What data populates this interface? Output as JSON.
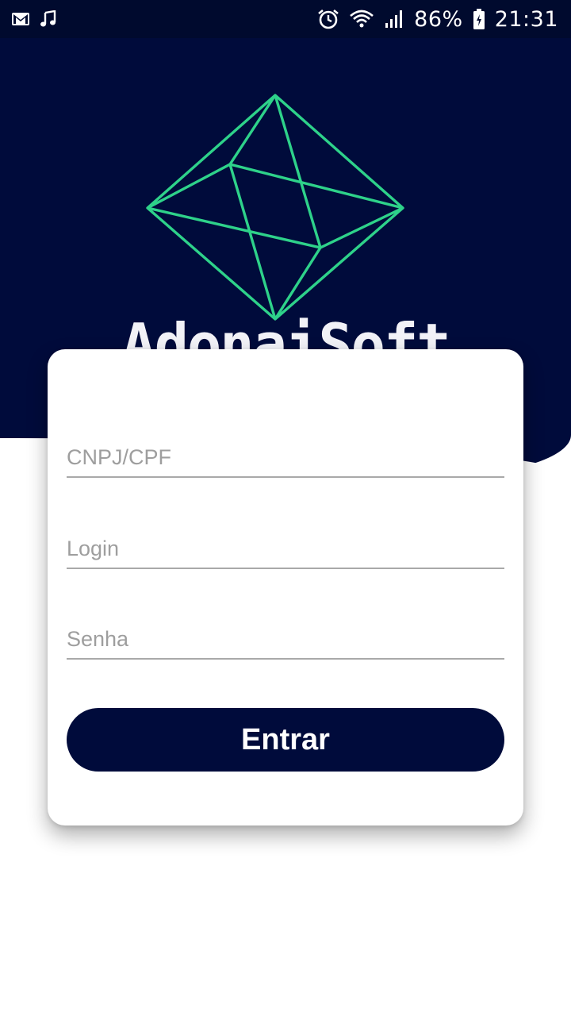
{
  "status_bar": {
    "battery": "86%",
    "time": "21:31",
    "left_icons": [
      "gmail-icon",
      "music-note-icon"
    ],
    "right_icons": [
      "alarm-icon",
      "wifi-icon",
      "signal-icon",
      "battery-icon"
    ]
  },
  "brand": {
    "name": "AdonaiSoft",
    "logo_color": "#2ed28a",
    "header_color": "#000b3b"
  },
  "form": {
    "cnpj_placeholder": "CNPJ/CPF",
    "login_placeholder": "Login",
    "password_placeholder": "Senha",
    "submit_label": "Entrar"
  }
}
